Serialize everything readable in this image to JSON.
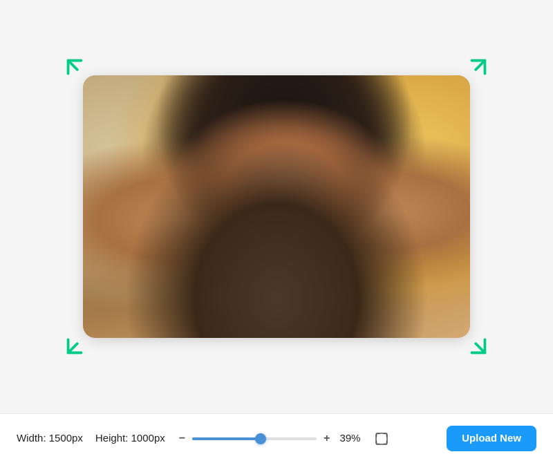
{
  "toolbar": {
    "width_label": "Width: 1500px",
    "height_label": "Height: 1000px",
    "separator": "   ",
    "minus_label": "−",
    "plus_label": "+",
    "zoom_label": "39%",
    "upload_button_label": "Upload New",
    "slider_fill_percent": 55
  },
  "canvas": {
    "corner_top_left": "↖",
    "corner_top_right": "↗",
    "corner_bottom_left": "↙",
    "corner_bottom_right": "↘"
  },
  "colors": {
    "arrow": "#00cc88",
    "slider_fill": "#4a90d9",
    "upload_btn": "#1a9bfc",
    "upload_btn_text": "#ffffff"
  }
}
